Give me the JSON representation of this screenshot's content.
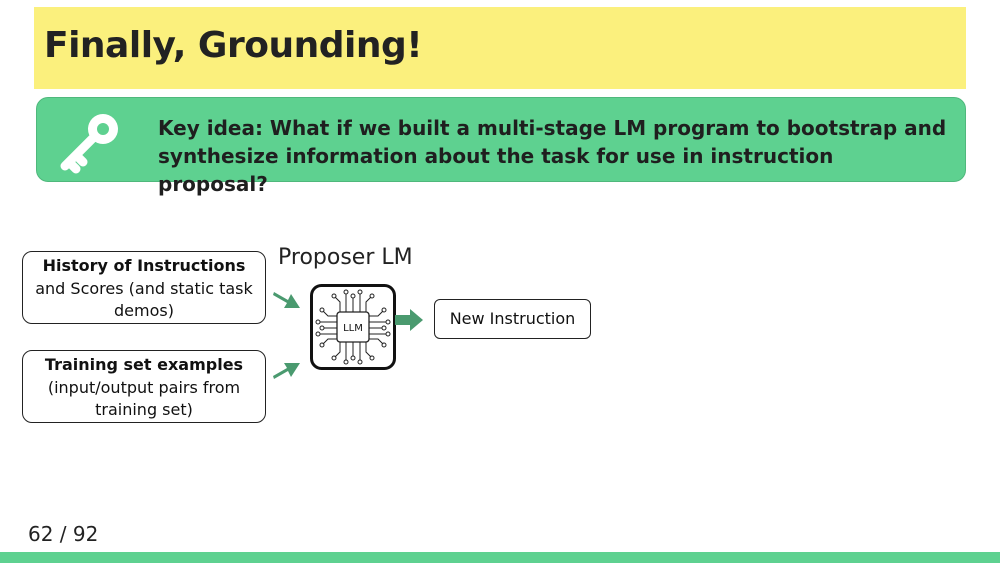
{
  "title": "Finally, Grounding!",
  "key_idea": {
    "icon": "key-icon",
    "text": "Key idea: What if we built a multi-stage LM program to bootstrap and synthesize information about the task for use in instruction proposal?"
  },
  "diagram": {
    "proposer_label": "Proposer LM",
    "input_history": {
      "bold": "History of Instructions",
      "rest": " and Scores (and static task demos)"
    },
    "input_training": {
      "bold": "Training set examples",
      "rest": "(input/output pairs from training set)"
    },
    "chip_label": "LLM",
    "output_label": "New Instruction"
  },
  "page_number": "62 / 92",
  "colors": {
    "title_bg": "#fbf07d",
    "key_box_bg": "#5ed190",
    "arrow": "#4a9a6f",
    "footer": "#5ed190"
  }
}
